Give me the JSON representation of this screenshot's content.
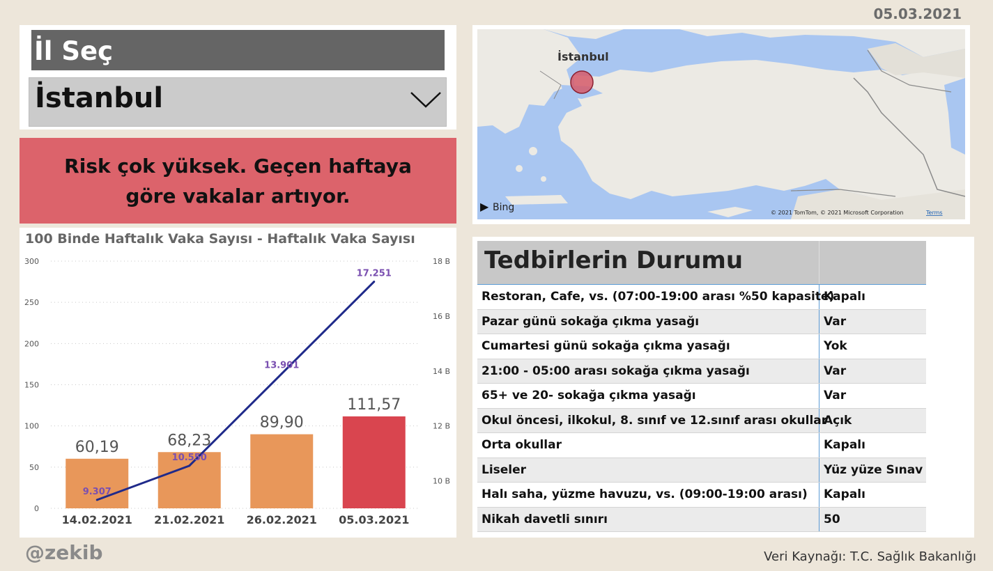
{
  "header": {
    "date": "05.03.2021"
  },
  "slicer": {
    "title": "İl Seç",
    "selected": "İstanbul"
  },
  "risk": {
    "message": "Risk çok yüksek. Geçen haftaya göre vakalar artıyor."
  },
  "chart": {
    "title": "100 Binde Haftalık Vaka Sayısı - Haftalık Vaka Sayısı"
  },
  "chart_data": {
    "type": "bar",
    "title": "100 Binde Haftalık Vaka Sayısı - Haftalık Vaka Sayısı",
    "categories": [
      "14.02.2021",
      "21.02.2021",
      "26.02.2021",
      "05.03.2021"
    ],
    "series": [
      {
        "name": "100 Binde Haftalık Vaka Sayısı",
        "type": "bar",
        "axis": "left",
        "values": [
          60.19,
          68.23,
          89.9,
          111.57
        ],
        "labels": [
          "60,19",
          "68,23",
          "89,90",
          "111,57"
        ],
        "colors": [
          "#e8975a",
          "#e8975a",
          "#e8975a",
          "#d9454f"
        ]
      },
      {
        "name": "Haftalık Vaka Sayısı",
        "type": "line",
        "axis": "right",
        "values": [
          9307,
          10550,
          13901,
          17251
        ],
        "labels": [
          "9.307",
          "10.550",
          "13.901",
          "17.251"
        ],
        "color": "#1f2a8a"
      }
    ],
    "y_left": {
      "range": [
        0,
        300
      ],
      "ticks": [
        "0",
        "50",
        "100",
        "150",
        "200",
        "250",
        "300"
      ]
    },
    "y_right": {
      "range": [
        9000,
        18000
      ],
      "ticks": [
        "10 B",
        "12 B",
        "14 B",
        "16 B",
        "18 B"
      ]
    },
    "grid": true
  },
  "map": {
    "city_label": "İstanbul",
    "provider": "Bing",
    "copyright": "© 2021 TomTom, © 2021 Microsoft Corporation",
    "terms": "Terms"
  },
  "table": {
    "title": "Tedbirlerin Durumu",
    "rows": [
      {
        "measure": "Restoran, Cafe, vs. (07:00-19:00 arası %50 kapasite)",
        "status": "Kapalı"
      },
      {
        "measure": "Pazar günü sokağa çıkma yasağı",
        "status": "Var"
      },
      {
        "measure": "Cumartesi günü sokağa çıkma yasağı",
        "status": "Yok"
      },
      {
        "measure": "21:00 - 05:00 arası sokağa çıkma yasağı",
        "status": "Var"
      },
      {
        "measure": "65+ ve 20- sokağa çıkma yasağı",
        "status": "Var"
      },
      {
        "measure": "Okul öncesi, ilkokul, 8. sınıf ve 12.sınıf arası okullar",
        "status": "Açık"
      },
      {
        "measure": "Orta okullar",
        "status": "Kapalı"
      },
      {
        "measure": "Liseler",
        "status": "Yüz yüze Sınav"
      },
      {
        "measure": "Halı saha, yüzme havuzu, vs. (09:00-19:00 arası)",
        "status": "Kapalı"
      },
      {
        "measure": "Nikah davetli sınırı",
        "status": "50"
      }
    ]
  },
  "footer": {
    "author": "@zekib",
    "source": "Veri Kaynağı: T.C. Sağlık Bakanlığı"
  }
}
